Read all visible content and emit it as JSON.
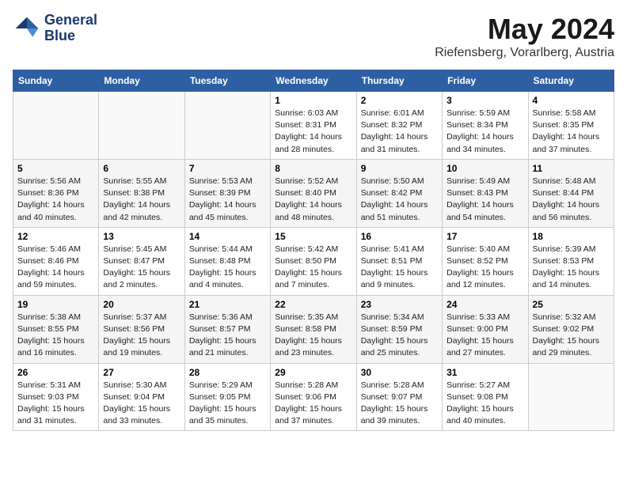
{
  "logo": {
    "line1": "General",
    "line2": "Blue"
  },
  "title": "May 2024",
  "location": "Riefensberg, Vorarlberg, Austria",
  "days_of_week": [
    "Sunday",
    "Monday",
    "Tuesday",
    "Wednesday",
    "Thursday",
    "Friday",
    "Saturday"
  ],
  "weeks": [
    [
      {
        "day": "",
        "sunrise": "",
        "sunset": "",
        "daylight": ""
      },
      {
        "day": "",
        "sunrise": "",
        "sunset": "",
        "daylight": ""
      },
      {
        "day": "",
        "sunrise": "",
        "sunset": "",
        "daylight": ""
      },
      {
        "day": "1",
        "sunrise": "Sunrise: 6:03 AM",
        "sunset": "Sunset: 8:31 PM",
        "daylight": "Daylight: 14 hours and 28 minutes."
      },
      {
        "day": "2",
        "sunrise": "Sunrise: 6:01 AM",
        "sunset": "Sunset: 8:32 PM",
        "daylight": "Daylight: 14 hours and 31 minutes."
      },
      {
        "day": "3",
        "sunrise": "Sunrise: 5:59 AM",
        "sunset": "Sunset: 8:34 PM",
        "daylight": "Daylight: 14 hours and 34 minutes."
      },
      {
        "day": "4",
        "sunrise": "Sunrise: 5:58 AM",
        "sunset": "Sunset: 8:35 PM",
        "daylight": "Daylight: 14 hours and 37 minutes."
      }
    ],
    [
      {
        "day": "5",
        "sunrise": "Sunrise: 5:56 AM",
        "sunset": "Sunset: 8:36 PM",
        "daylight": "Daylight: 14 hours and 40 minutes."
      },
      {
        "day": "6",
        "sunrise": "Sunrise: 5:55 AM",
        "sunset": "Sunset: 8:38 PM",
        "daylight": "Daylight: 14 hours and 42 minutes."
      },
      {
        "day": "7",
        "sunrise": "Sunrise: 5:53 AM",
        "sunset": "Sunset: 8:39 PM",
        "daylight": "Daylight: 14 hours and 45 minutes."
      },
      {
        "day": "8",
        "sunrise": "Sunrise: 5:52 AM",
        "sunset": "Sunset: 8:40 PM",
        "daylight": "Daylight: 14 hours and 48 minutes."
      },
      {
        "day": "9",
        "sunrise": "Sunrise: 5:50 AM",
        "sunset": "Sunset: 8:42 PM",
        "daylight": "Daylight: 14 hours and 51 minutes."
      },
      {
        "day": "10",
        "sunrise": "Sunrise: 5:49 AM",
        "sunset": "Sunset: 8:43 PM",
        "daylight": "Daylight: 14 hours and 54 minutes."
      },
      {
        "day": "11",
        "sunrise": "Sunrise: 5:48 AM",
        "sunset": "Sunset: 8:44 PM",
        "daylight": "Daylight: 14 hours and 56 minutes."
      }
    ],
    [
      {
        "day": "12",
        "sunrise": "Sunrise: 5:46 AM",
        "sunset": "Sunset: 8:46 PM",
        "daylight": "Daylight: 14 hours and 59 minutes."
      },
      {
        "day": "13",
        "sunrise": "Sunrise: 5:45 AM",
        "sunset": "Sunset: 8:47 PM",
        "daylight": "Daylight: 15 hours and 2 minutes."
      },
      {
        "day": "14",
        "sunrise": "Sunrise: 5:44 AM",
        "sunset": "Sunset: 8:48 PM",
        "daylight": "Daylight: 15 hours and 4 minutes."
      },
      {
        "day": "15",
        "sunrise": "Sunrise: 5:42 AM",
        "sunset": "Sunset: 8:50 PM",
        "daylight": "Daylight: 15 hours and 7 minutes."
      },
      {
        "day": "16",
        "sunrise": "Sunrise: 5:41 AM",
        "sunset": "Sunset: 8:51 PM",
        "daylight": "Daylight: 15 hours and 9 minutes."
      },
      {
        "day": "17",
        "sunrise": "Sunrise: 5:40 AM",
        "sunset": "Sunset: 8:52 PM",
        "daylight": "Daylight: 15 hours and 12 minutes."
      },
      {
        "day": "18",
        "sunrise": "Sunrise: 5:39 AM",
        "sunset": "Sunset: 8:53 PM",
        "daylight": "Daylight: 15 hours and 14 minutes."
      }
    ],
    [
      {
        "day": "19",
        "sunrise": "Sunrise: 5:38 AM",
        "sunset": "Sunset: 8:55 PM",
        "daylight": "Daylight: 15 hours and 16 minutes."
      },
      {
        "day": "20",
        "sunrise": "Sunrise: 5:37 AM",
        "sunset": "Sunset: 8:56 PM",
        "daylight": "Daylight: 15 hours and 19 minutes."
      },
      {
        "day": "21",
        "sunrise": "Sunrise: 5:36 AM",
        "sunset": "Sunset: 8:57 PM",
        "daylight": "Daylight: 15 hours and 21 minutes."
      },
      {
        "day": "22",
        "sunrise": "Sunrise: 5:35 AM",
        "sunset": "Sunset: 8:58 PM",
        "daylight": "Daylight: 15 hours and 23 minutes."
      },
      {
        "day": "23",
        "sunrise": "Sunrise: 5:34 AM",
        "sunset": "Sunset: 8:59 PM",
        "daylight": "Daylight: 15 hours and 25 minutes."
      },
      {
        "day": "24",
        "sunrise": "Sunrise: 5:33 AM",
        "sunset": "Sunset: 9:00 PM",
        "daylight": "Daylight: 15 hours and 27 minutes."
      },
      {
        "day": "25",
        "sunrise": "Sunrise: 5:32 AM",
        "sunset": "Sunset: 9:02 PM",
        "daylight": "Daylight: 15 hours and 29 minutes."
      }
    ],
    [
      {
        "day": "26",
        "sunrise": "Sunrise: 5:31 AM",
        "sunset": "Sunset: 9:03 PM",
        "daylight": "Daylight: 15 hours and 31 minutes."
      },
      {
        "day": "27",
        "sunrise": "Sunrise: 5:30 AM",
        "sunset": "Sunset: 9:04 PM",
        "daylight": "Daylight: 15 hours and 33 minutes."
      },
      {
        "day": "28",
        "sunrise": "Sunrise: 5:29 AM",
        "sunset": "Sunset: 9:05 PM",
        "daylight": "Daylight: 15 hours and 35 minutes."
      },
      {
        "day": "29",
        "sunrise": "Sunrise: 5:28 AM",
        "sunset": "Sunset: 9:06 PM",
        "daylight": "Daylight: 15 hours and 37 minutes."
      },
      {
        "day": "30",
        "sunrise": "Sunrise: 5:28 AM",
        "sunset": "Sunset: 9:07 PM",
        "daylight": "Daylight: 15 hours and 39 minutes."
      },
      {
        "day": "31",
        "sunrise": "Sunrise: 5:27 AM",
        "sunset": "Sunset: 9:08 PM",
        "daylight": "Daylight: 15 hours and 40 minutes."
      },
      {
        "day": "",
        "sunrise": "",
        "sunset": "",
        "daylight": ""
      }
    ]
  ]
}
